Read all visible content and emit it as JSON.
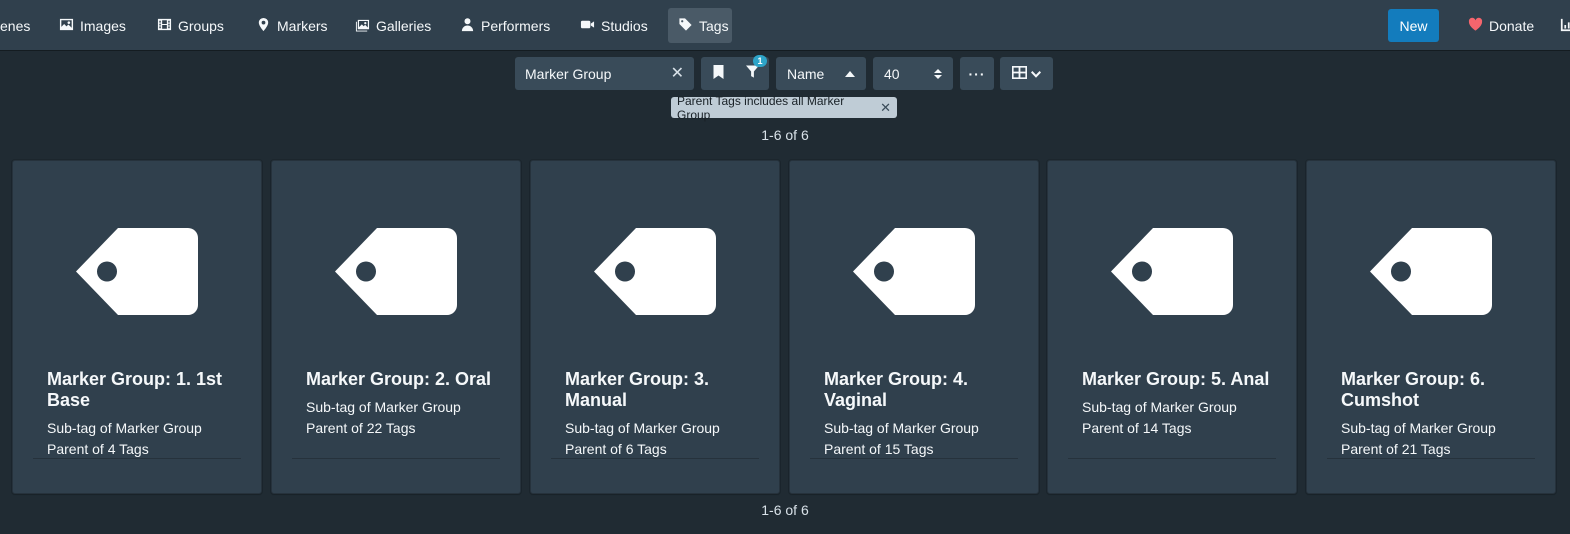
{
  "nav": {
    "items": [
      {
        "label": "enes",
        "icon": "film-icon"
      },
      {
        "label": "Images",
        "icon": "image-icon"
      },
      {
        "label": "Groups",
        "icon": "film-icon"
      },
      {
        "label": "Markers",
        "icon": "map-marker-icon"
      },
      {
        "label": "Galleries",
        "icon": "images-icon"
      },
      {
        "label": "Performers",
        "icon": "user-icon"
      },
      {
        "label": "Studios",
        "icon": "video-icon"
      },
      {
        "label": "Tags",
        "icon": "tag-icon"
      }
    ],
    "new_label": "New",
    "donate_label": "Donate"
  },
  "toolbar": {
    "search_value": "Marker Group",
    "filter_count": "1",
    "sort_label": "Name",
    "per_page": "40",
    "more_label": "···"
  },
  "filter_tag": {
    "label": "Parent Tags includes all Marker Group"
  },
  "pagination": {
    "top": "1-6 of 6",
    "bottom": "1-6 of 6"
  },
  "cards": [
    {
      "title": "Marker Group: 1. 1st Base",
      "sub_tag": "Sub-tag of Marker Group",
      "parent_of": "Parent of 4 Tags"
    },
    {
      "title": "Marker Group: 2. Oral",
      "sub_tag": "Sub-tag of Marker Group",
      "parent_of": "Parent of 22 Tags"
    },
    {
      "title": "Marker Group: 3. Manual",
      "sub_tag": "Sub-tag of Marker Group",
      "parent_of": "Parent of 6 Tags"
    },
    {
      "title": "Marker Group: 4. Vaginal",
      "sub_tag": "Sub-tag of Marker Group",
      "parent_of": "Parent of 15 Tags"
    },
    {
      "title": "Marker Group: 5. Anal",
      "sub_tag": "Sub-tag of Marker Group",
      "parent_of": "Parent of 14 Tags"
    },
    {
      "title": "Marker Group: 6. Cumshot",
      "sub_tag": "Sub-tag of Marker Group",
      "parent_of": "Parent of 21 Tags"
    }
  ],
  "colors": {
    "background": "#202b33",
    "navbar": "#30404d",
    "card": "#30404d",
    "primary": "#137cbd",
    "donate_heart": "#f5656d",
    "badge": "#2ea4c8"
  }
}
